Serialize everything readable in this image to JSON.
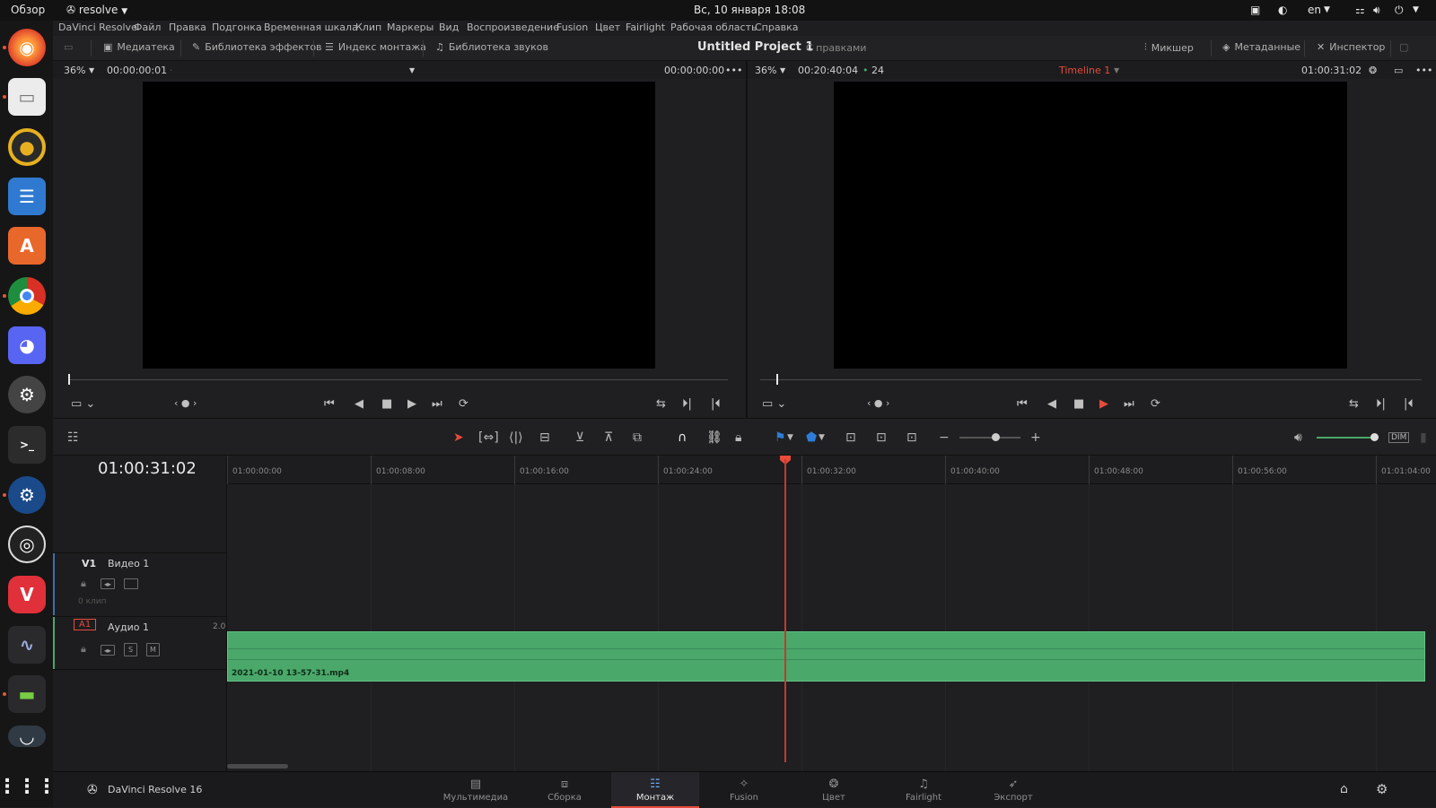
{
  "topbar": {
    "overview": "Обзор",
    "app_name": "resolve",
    "clock": "Вс, 10 января  18:08",
    "lang": "en"
  },
  "menubar": {
    "items": [
      "DaVinci Resolve",
      "Файл",
      "Правка",
      "Подгонка",
      "Временная шкала",
      "Клип",
      "Маркеры",
      "Вид",
      "Воспроизведение",
      "Fusion",
      "Цвет",
      "Fairlight",
      "Рабочая область",
      "Справка"
    ]
  },
  "toolbar": {
    "media_pool": "Медиатека",
    "effects_library": "Библиотека эффектов",
    "edit_index": "Индекс монтажа",
    "sound_library": "Библиотека звуков",
    "project_title": "Untitled Project 1",
    "project_status": "С правками",
    "mixer": "Микшер",
    "metadata": "Метаданные",
    "inspector": "Инспектор"
  },
  "source_viewer": {
    "zoom": "36%",
    "timecode_in": "00:00:00:01",
    "timecode_out": "00:00:00:00"
  },
  "timeline_viewer": {
    "zoom": "36%",
    "duration": "00:20:40:04",
    "fps": "24",
    "timeline_name": "Timeline 1",
    "timecode": "01:00:31:02"
  },
  "timeline": {
    "current_timecode": "01:00:31:02",
    "ruler": [
      "01:00:00:00",
      "01:00:08:00",
      "01:00:16:00",
      "01:00:24:00",
      "01:00:32:00",
      "01:00:40:00",
      "01:00:48:00",
      "01:00:56:00",
      "01:01:04:00"
    ],
    "video_track": {
      "id": "V1",
      "name": "Видео 1",
      "clip_count": "0 клип"
    },
    "audio_track": {
      "id": "A1",
      "name": "Аудио 1",
      "channels": "2.0",
      "solo": "S",
      "mute": "M"
    },
    "audio_clip_name": "2021-01-10 13-57-31.mp4"
  },
  "pagebar": {
    "brand": "DaVinci Resolve 16",
    "pages": [
      "Мультимедиа",
      "Сборка",
      "Монтаж",
      "Fusion",
      "Цвет",
      "Fairlight",
      "Экспорт"
    ],
    "active_index": 2
  },
  "colors": {
    "accent_red": "#e64b3c",
    "audio_clip": "#4aa86a",
    "playhead": "#e64b3c",
    "selection_blue": "#2d7cd8"
  }
}
